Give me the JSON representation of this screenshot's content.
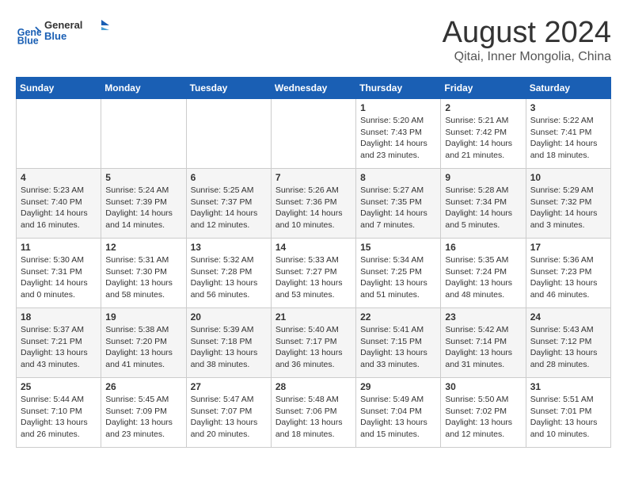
{
  "logo": {
    "line1": "General",
    "line2": "Blue"
  },
  "title": "August 2024",
  "subtitle": "Qitai, Inner Mongolia, China",
  "days_of_week": [
    "Sunday",
    "Monday",
    "Tuesday",
    "Wednesday",
    "Thursday",
    "Friday",
    "Saturday"
  ],
  "weeks": [
    [
      {
        "day": "",
        "text": ""
      },
      {
        "day": "",
        "text": ""
      },
      {
        "day": "",
        "text": ""
      },
      {
        "day": "",
        "text": ""
      },
      {
        "day": "1",
        "text": "Sunrise: 5:20 AM\nSunset: 7:43 PM\nDaylight: 14 hours\nand 23 minutes."
      },
      {
        "day": "2",
        "text": "Sunrise: 5:21 AM\nSunset: 7:42 PM\nDaylight: 14 hours\nand 21 minutes."
      },
      {
        "day": "3",
        "text": "Sunrise: 5:22 AM\nSunset: 7:41 PM\nDaylight: 14 hours\nand 18 minutes."
      }
    ],
    [
      {
        "day": "4",
        "text": "Sunrise: 5:23 AM\nSunset: 7:40 PM\nDaylight: 14 hours\nand 16 minutes."
      },
      {
        "day": "5",
        "text": "Sunrise: 5:24 AM\nSunset: 7:39 PM\nDaylight: 14 hours\nand 14 minutes."
      },
      {
        "day": "6",
        "text": "Sunrise: 5:25 AM\nSunset: 7:37 PM\nDaylight: 14 hours\nand 12 minutes."
      },
      {
        "day": "7",
        "text": "Sunrise: 5:26 AM\nSunset: 7:36 PM\nDaylight: 14 hours\nand 10 minutes."
      },
      {
        "day": "8",
        "text": "Sunrise: 5:27 AM\nSunset: 7:35 PM\nDaylight: 14 hours\nand 7 minutes."
      },
      {
        "day": "9",
        "text": "Sunrise: 5:28 AM\nSunset: 7:34 PM\nDaylight: 14 hours\nand 5 minutes."
      },
      {
        "day": "10",
        "text": "Sunrise: 5:29 AM\nSunset: 7:32 PM\nDaylight: 14 hours\nand 3 minutes."
      }
    ],
    [
      {
        "day": "11",
        "text": "Sunrise: 5:30 AM\nSunset: 7:31 PM\nDaylight: 14 hours\nand 0 minutes."
      },
      {
        "day": "12",
        "text": "Sunrise: 5:31 AM\nSunset: 7:30 PM\nDaylight: 13 hours\nand 58 minutes."
      },
      {
        "day": "13",
        "text": "Sunrise: 5:32 AM\nSunset: 7:28 PM\nDaylight: 13 hours\nand 56 minutes."
      },
      {
        "day": "14",
        "text": "Sunrise: 5:33 AM\nSunset: 7:27 PM\nDaylight: 13 hours\nand 53 minutes."
      },
      {
        "day": "15",
        "text": "Sunrise: 5:34 AM\nSunset: 7:25 PM\nDaylight: 13 hours\nand 51 minutes."
      },
      {
        "day": "16",
        "text": "Sunrise: 5:35 AM\nSunset: 7:24 PM\nDaylight: 13 hours\nand 48 minutes."
      },
      {
        "day": "17",
        "text": "Sunrise: 5:36 AM\nSunset: 7:23 PM\nDaylight: 13 hours\nand 46 minutes."
      }
    ],
    [
      {
        "day": "18",
        "text": "Sunrise: 5:37 AM\nSunset: 7:21 PM\nDaylight: 13 hours\nand 43 minutes."
      },
      {
        "day": "19",
        "text": "Sunrise: 5:38 AM\nSunset: 7:20 PM\nDaylight: 13 hours\nand 41 minutes."
      },
      {
        "day": "20",
        "text": "Sunrise: 5:39 AM\nSunset: 7:18 PM\nDaylight: 13 hours\nand 38 minutes."
      },
      {
        "day": "21",
        "text": "Sunrise: 5:40 AM\nSunset: 7:17 PM\nDaylight: 13 hours\nand 36 minutes."
      },
      {
        "day": "22",
        "text": "Sunrise: 5:41 AM\nSunset: 7:15 PM\nDaylight: 13 hours\nand 33 minutes."
      },
      {
        "day": "23",
        "text": "Sunrise: 5:42 AM\nSunset: 7:14 PM\nDaylight: 13 hours\nand 31 minutes."
      },
      {
        "day": "24",
        "text": "Sunrise: 5:43 AM\nSunset: 7:12 PM\nDaylight: 13 hours\nand 28 minutes."
      }
    ],
    [
      {
        "day": "25",
        "text": "Sunrise: 5:44 AM\nSunset: 7:10 PM\nDaylight: 13 hours\nand 26 minutes."
      },
      {
        "day": "26",
        "text": "Sunrise: 5:45 AM\nSunset: 7:09 PM\nDaylight: 13 hours\nand 23 minutes."
      },
      {
        "day": "27",
        "text": "Sunrise: 5:47 AM\nSunset: 7:07 PM\nDaylight: 13 hours\nand 20 minutes."
      },
      {
        "day": "28",
        "text": "Sunrise: 5:48 AM\nSunset: 7:06 PM\nDaylight: 13 hours\nand 18 minutes."
      },
      {
        "day": "29",
        "text": "Sunrise: 5:49 AM\nSunset: 7:04 PM\nDaylight: 13 hours\nand 15 minutes."
      },
      {
        "day": "30",
        "text": "Sunrise: 5:50 AM\nSunset: 7:02 PM\nDaylight: 13 hours\nand 12 minutes."
      },
      {
        "day": "31",
        "text": "Sunrise: 5:51 AM\nSunset: 7:01 PM\nDaylight: 13 hours\nand 10 minutes."
      }
    ]
  ]
}
